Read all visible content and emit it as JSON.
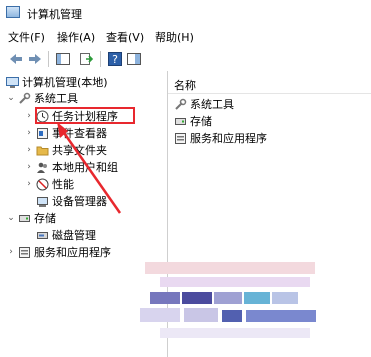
{
  "window": {
    "title": "计算机管理"
  },
  "menu": {
    "items": [
      "文件(F)",
      "操作(A)",
      "查看(V)",
      "帮助(H)"
    ]
  },
  "tree": {
    "root": "计算机管理(本地)",
    "system_tools": "系统工具",
    "task_scheduler": "任务计划程序",
    "event_viewer": "事件查看器",
    "shared_folders": "共享文件夹",
    "local_users": "本地用户和组",
    "performance": "性能",
    "device_manager": "设备管理器",
    "storage": "存储",
    "disk_management": "磁盘管理",
    "services": "服务和应用程序"
  },
  "list": {
    "header": "名称",
    "items": [
      "系统工具",
      "存储",
      "服务和应用程序"
    ]
  },
  "colors": {
    "annotation_red": "#e8282e",
    "folder_yellow": "#e6b94a"
  }
}
